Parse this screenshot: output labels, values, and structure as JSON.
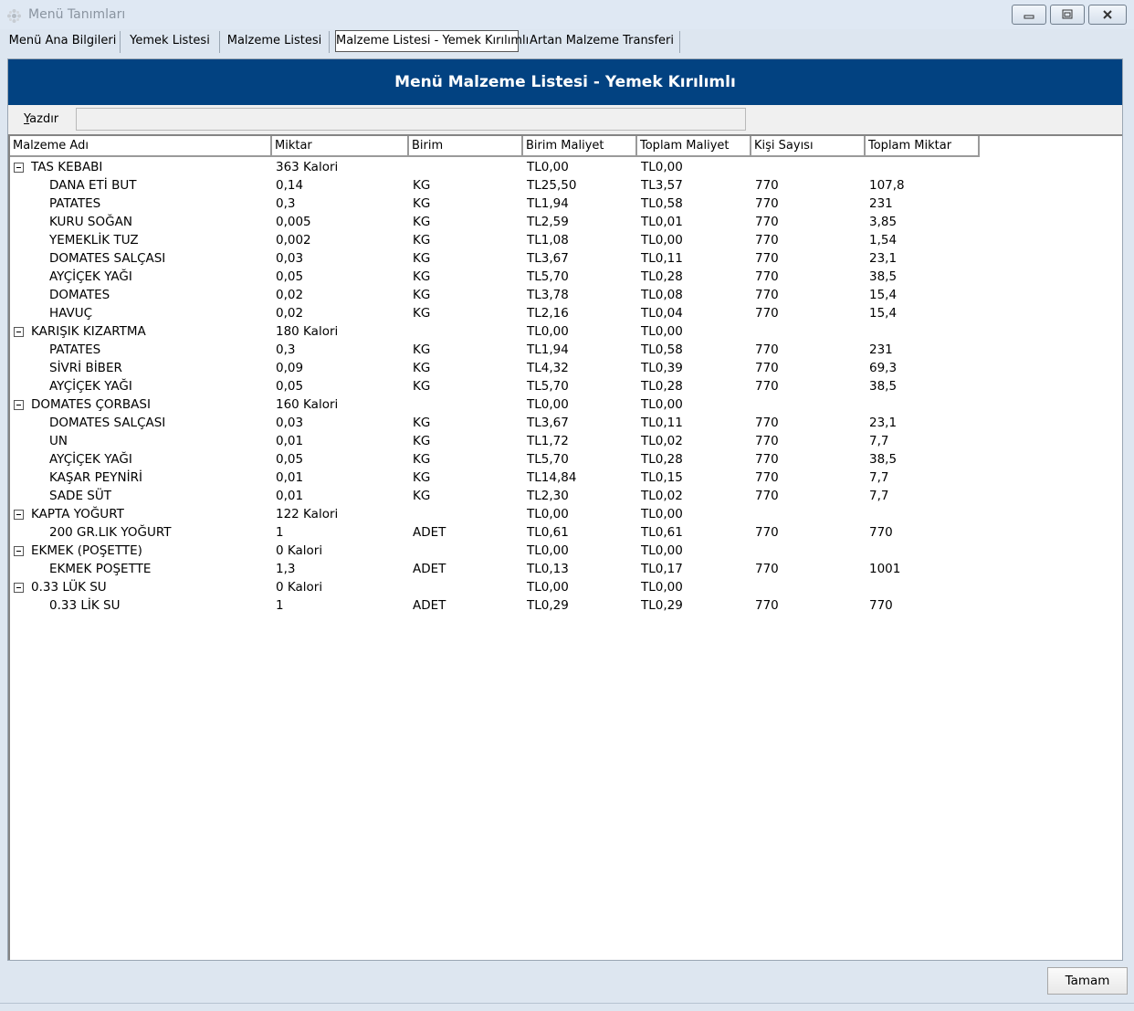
{
  "window": {
    "title": "Menü Tanımları",
    "minimize_icon": "minimize-icon",
    "restore_icon": "restore-icon",
    "close_icon": "close-icon"
  },
  "tabs": [
    {
      "label": "Menü Ana Bilgileri"
    },
    {
      "label": "Yemek Listesi"
    },
    {
      "label": "Malzeme Listesi"
    },
    {
      "label": "Malzeme Listesi - Yemek Kırılımlı",
      "active": true
    },
    {
      "label": "Artan Malzeme Transferi"
    }
  ],
  "header": {
    "title": "Menü Malzeme Listesi - Yemek Kırılımlı",
    "color": "#024281"
  },
  "toolbar": {
    "print_label_prefix": "Y",
    "print_label_rest": "azdır"
  },
  "grid": {
    "columns": [
      "Malzeme Adı",
      "Miktar",
      "Birim",
      "Birim Maliyet",
      "Toplam Maliyet",
      "Kişi Sayısı",
      "Toplam Miktar"
    ],
    "rows": [
      {
        "level": 0,
        "cells": [
          "TAS KEBABI",
          "363 Kalori",
          "",
          "TL0,00",
          "TL0,00",
          "",
          ""
        ]
      },
      {
        "level": 1,
        "cells": [
          "DANA ETİ BUT",
          "0,14",
          "KG",
          "TL25,50",
          "TL3,57",
          "770",
          "107,8"
        ]
      },
      {
        "level": 1,
        "cells": [
          "PATATES",
          "0,3",
          "KG",
          "TL1,94",
          "TL0,58",
          "770",
          "231"
        ]
      },
      {
        "level": 1,
        "cells": [
          "KURU SOĞAN",
          "0,005",
          "KG",
          "TL2,59",
          "TL0,01",
          "770",
          "3,85"
        ]
      },
      {
        "level": 1,
        "cells": [
          "YEMEKLİK TUZ",
          "0,002",
          "KG",
          "TL1,08",
          "TL0,00",
          "770",
          "1,54"
        ]
      },
      {
        "level": 1,
        "cells": [
          "DOMATES SALÇASI",
          "0,03",
          "KG",
          "TL3,67",
          "TL0,11",
          "770",
          "23,1"
        ]
      },
      {
        "level": 1,
        "cells": [
          "AYÇİÇEK YAĞI",
          "0,05",
          "KG",
          "TL5,70",
          "TL0,28",
          "770",
          "38,5"
        ]
      },
      {
        "level": 1,
        "cells": [
          "DOMATES",
          "0,02",
          "KG",
          "TL3,78",
          "TL0,08",
          "770",
          "15,4"
        ]
      },
      {
        "level": 1,
        "cells": [
          "HAVUÇ",
          "0,02",
          "KG",
          "TL2,16",
          "TL0,04",
          "770",
          "15,4"
        ]
      },
      {
        "level": 0,
        "cells": [
          "KARIŞIK KIZARTMA",
          "180 Kalori",
          "",
          "TL0,00",
          "TL0,00",
          "",
          ""
        ]
      },
      {
        "level": 1,
        "cells": [
          "PATATES",
          "0,3",
          "KG",
          "TL1,94",
          "TL0,58",
          "770",
          "231"
        ]
      },
      {
        "level": 1,
        "cells": [
          "SİVRİ BİBER",
          "0,09",
          "KG",
          "TL4,32",
          "TL0,39",
          "770",
          "69,3"
        ]
      },
      {
        "level": 1,
        "cells": [
          "AYÇİÇEK YAĞI",
          "0,05",
          "KG",
          "TL5,70",
          "TL0,28",
          "770",
          "38,5"
        ]
      },
      {
        "level": 0,
        "cells": [
          "DOMATES ÇORBASI",
          "160 Kalori",
          "",
          "TL0,00",
          "TL0,00",
          "",
          ""
        ]
      },
      {
        "level": 1,
        "cells": [
          "DOMATES SALÇASI",
          "0,03",
          "KG",
          "TL3,67",
          "TL0,11",
          "770",
          "23,1"
        ]
      },
      {
        "level": 1,
        "cells": [
          "UN",
          "0,01",
          "KG",
          "TL1,72",
          "TL0,02",
          "770",
          "7,7"
        ]
      },
      {
        "level": 1,
        "cells": [
          "AYÇİÇEK YAĞI",
          "0,05",
          "KG",
          "TL5,70",
          "TL0,28",
          "770",
          "38,5"
        ]
      },
      {
        "level": 1,
        "cells": [
          "KAŞAR PEYNİRİ",
          "0,01",
          "KG",
          "TL14,84",
          "TL0,15",
          "770",
          "7,7"
        ]
      },
      {
        "level": 1,
        "cells": [
          "SADE SÜT",
          "0,01",
          "KG",
          "TL2,30",
          "TL0,02",
          "770",
          "7,7"
        ]
      },
      {
        "level": 0,
        "cells": [
          "KAPTA YOĞURT",
          "122 Kalori",
          "",
          "TL0,00",
          "TL0,00",
          "",
          ""
        ]
      },
      {
        "level": 1,
        "cells": [
          "200 GR.LIK YOĞURT",
          "1",
          "ADET",
          "TL0,61",
          "TL0,61",
          "770",
          "770"
        ]
      },
      {
        "level": 0,
        "cells": [
          "EKMEK (POŞETTE)",
          "0 Kalori",
          "",
          "TL0,00",
          "TL0,00",
          "",
          ""
        ]
      },
      {
        "level": 1,
        "cells": [
          "EKMEK POŞETTE",
          "1,3",
          "ADET",
          "TL0,13",
          "TL0,17",
          "770",
          "1001"
        ]
      },
      {
        "level": 0,
        "cells": [
          "0.33 LÜK SU",
          "0 Kalori",
          "",
          "TL0,00",
          "TL0,00",
          "",
          ""
        ]
      },
      {
        "level": 1,
        "cells": [
          "0.33 LİK SU",
          "1",
          "ADET",
          "TL0,29",
          "TL0,29",
          "770",
          "770"
        ]
      }
    ]
  },
  "footer": {
    "ok_label": "Tamam"
  }
}
